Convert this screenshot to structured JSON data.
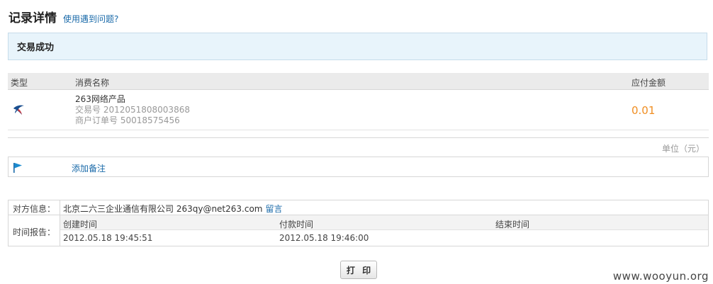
{
  "header": {
    "title": "记录详情",
    "help_link": "使用遇到问题?"
  },
  "status": {
    "text": "交易成功"
  },
  "table": {
    "columns": {
      "type": "类型",
      "name": "消费名称",
      "amount": "应付金额"
    },
    "row": {
      "icon": "swallow-bird-icon",
      "product": "263网络产品",
      "trade_no": "交易号 2012051808003868",
      "merchant_order": "商户订单号 50018575456",
      "amount": "0.01"
    },
    "unit": "单位（元）"
  },
  "note": {
    "icon": "flag-icon",
    "link": "添加备注"
  },
  "info": {
    "party_label": "对方信息：",
    "party_value": "北京二六三企业通信有限公司 263qy@net263.com",
    "message_link": "留言",
    "time_label": "时间报告：",
    "time_headers": [
      "创建时间",
      "付款时间",
      "结束时间"
    ],
    "time_values": [
      "2012.05.18 19:45:51",
      "2012.05.18 19:46:00",
      ""
    ]
  },
  "print_button": "打 印",
  "watermark": "www.wooyun.org",
  "colors": {
    "link": "#1a6aa9",
    "amount": "#f08e22",
    "status_bg": "#e8f4fb"
  }
}
